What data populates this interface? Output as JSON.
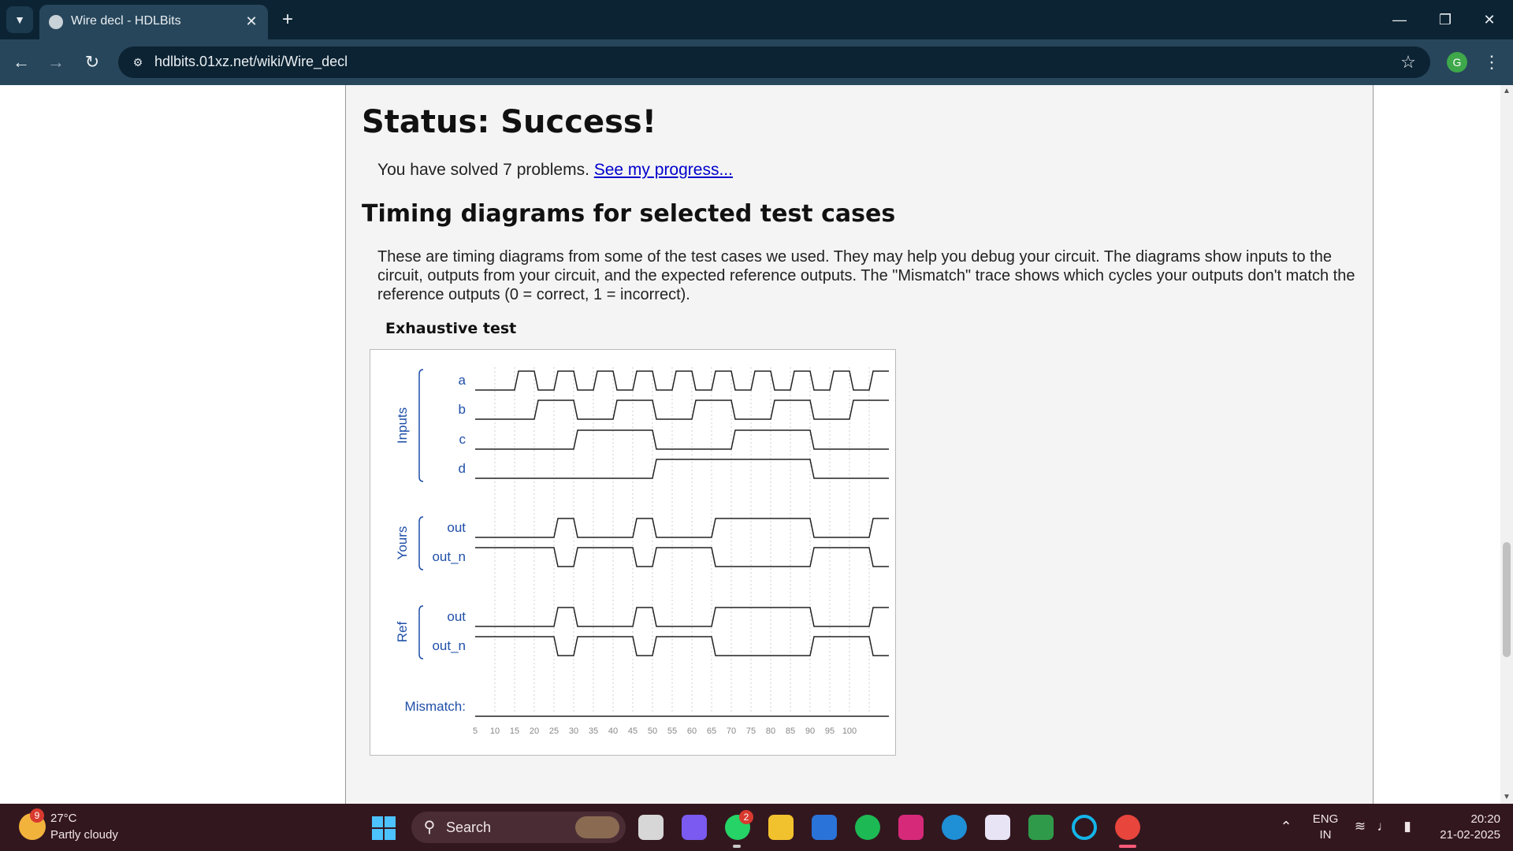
{
  "browser": {
    "tab_title": "Wire decl - HDLBits",
    "url": "hdlbits.01xz.net/wiki/Wire_decl",
    "profile_initial": "G"
  },
  "page": {
    "status_heading": "Status: Success!",
    "solved_text": "You have solved 7 problems. ",
    "progress_link": "See my progress...",
    "timing_heading": "Timing diagrams for selected test cases",
    "timing_description": "These are timing diagrams from some of the test cases we used. They may help you debug your circuit. The diagrams show inputs to the circuit, outputs from your circuit, and the expected reference outputs. The \"Mismatch\" trace shows which cycles your outputs don't match the reference outputs (0 = correct, 1 = incorrect).",
    "diagram_title": "Exhaustive test"
  },
  "diagram": {
    "groups": [
      {
        "label": "Inputs",
        "signals": [
          "a",
          "b",
          "c",
          "d"
        ]
      },
      {
        "label": "Yours",
        "signals": [
          "out",
          "out_n"
        ]
      },
      {
        "label": "Ref",
        "signals": [
          "out",
          "out_n"
        ]
      }
    ],
    "mismatch_label": "Mismatch:",
    "time_ticks": [
      "5",
      "10",
      "15",
      "20",
      "25",
      "30",
      "35",
      "40",
      "45",
      "50",
      "55",
      "60",
      "65",
      "70",
      "75",
      "80",
      "85",
      "90",
      "95",
      "100"
    ],
    "waveforms": {
      "a": [
        0,
        0,
        1,
        0,
        1,
        0,
        1,
        0,
        1,
        0,
        1,
        0,
        1,
        0,
        1,
        0,
        1,
        0,
        1,
        0,
        1
      ],
      "b": [
        0,
        0,
        0,
        1,
        1,
        0,
        0,
        1,
        1,
        0,
        0,
        1,
        1,
        0,
        0,
        1,
        1,
        0,
        0,
        1,
        1
      ],
      "c": [
        0,
        0,
        0,
        0,
        0,
        1,
        1,
        1,
        1,
        0,
        0,
        0,
        0,
        1,
        1,
        1,
        1,
        0,
        0,
        0,
        0
      ],
      "d": [
        0,
        0,
        0,
        0,
        0,
        0,
        0,
        0,
        0,
        1,
        1,
        1,
        1,
        1,
        1,
        1,
        1,
        0,
        0,
        0,
        0
      ],
      "yours_out": [
        0,
        0,
        0,
        0,
        1,
        0,
        0,
        0,
        1,
        0,
        0,
        0,
        1,
        1,
        1,
        1,
        1,
        0,
        0,
        0,
        1
      ],
      "yours_out_n": [
        1,
        1,
        1,
        1,
        0,
        1,
        1,
        1,
        0,
        1,
        1,
        1,
        0,
        0,
        0,
        0,
        0,
        1,
        1,
        1,
        0
      ],
      "ref_out": [
        0,
        0,
        0,
        0,
        1,
        0,
        0,
        0,
        1,
        0,
        0,
        0,
        1,
        1,
        1,
        1,
        1,
        0,
        0,
        0,
        1
      ],
      "ref_out_n": [
        1,
        1,
        1,
        1,
        0,
        1,
        1,
        1,
        0,
        1,
        1,
        1,
        0,
        0,
        0,
        0,
        0,
        1,
        1,
        1,
        0
      ],
      "mismatch": [
        0,
        0,
        0,
        0,
        0,
        0,
        0,
        0,
        0,
        0,
        0,
        0,
        0,
        0,
        0,
        0,
        0,
        0,
        0,
        0,
        0
      ]
    }
  },
  "taskbar": {
    "weather_temp": "27°C",
    "weather_desc": "Partly cloudy",
    "weather_badge": "9",
    "search_label": "Search",
    "whatsapp_badge": "2",
    "lang_line1": "ENG",
    "lang_line2": "IN",
    "time": "20:20",
    "date": "21-02-2025"
  },
  "colors": {
    "tab_bar": "#0c2333",
    "toolbar": "#27465b",
    "link": "#0000cc",
    "diagram_label": "#1f4fa8",
    "taskbar": "#33171f"
  }
}
